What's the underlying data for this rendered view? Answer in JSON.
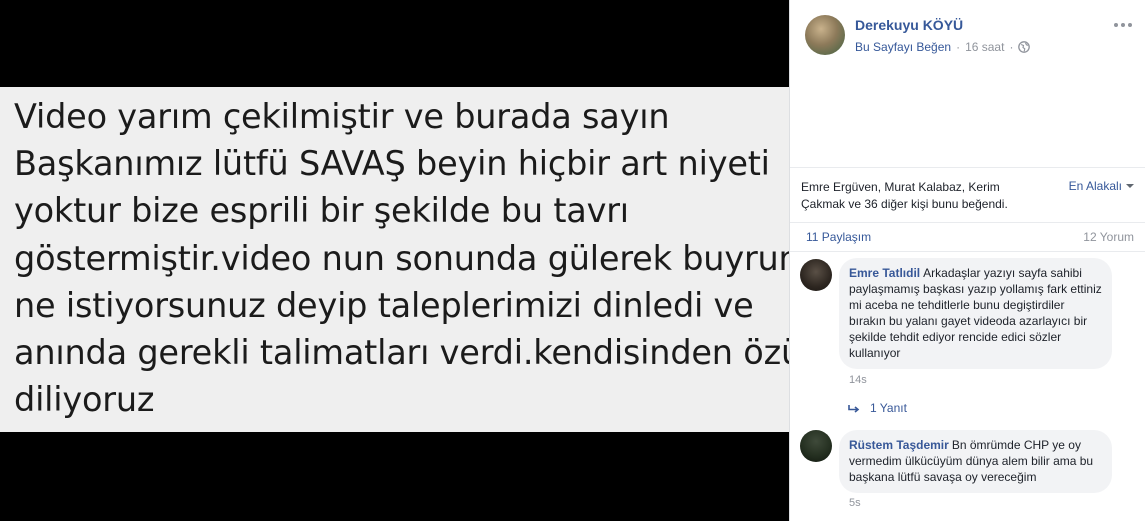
{
  "media": {
    "text": "Video yarım çekilmiştir ve burada sayın\nBaşkanımız lütfü SAVAŞ beyin hiçbir art niyeti\nyoktur bize esprili bir şekilde bu tavrı\ngöstermiştir.video nun sonunda gülerek buyrun\nne istiyorsunuz deyip taleplerimizi dinledi ve\nanında gerekli talimatları verdi.kendisinden özür\ndiliyoruz"
  },
  "post": {
    "page_name": "Derekuyu KÖYÜ",
    "like_page": "Bu Sayfayı Beğen",
    "separator": "·",
    "time": "16 saat",
    "privacy_icon": "globe-icon",
    "more_icon": "more-options-icon"
  },
  "reactions": {
    "text": "Emre Ergüven, Murat Kalabaz, Kerim Çakmak ve 36 diğer kişi bunu beğendi.",
    "sort_label": "En Alakalı"
  },
  "counts": {
    "shares": "11 Paylaşım",
    "comments": "12 Yorum"
  },
  "comments": [
    {
      "author": "Emre Tatlıdil",
      "text": "Arkadaşlar yazıyı sayfa sahibi paylaşmamış başkası yazıp yollamış fark ettiniz mi aceba ne tehditlerle bunu degiştirdiler bırakın bu yalanı gayet videoda azarlayıcı bir şekilde tehdit ediyor rencide edici sözler kullanıyor",
      "time": "14s",
      "reply_label": "1 Yanıt"
    },
    {
      "author": "Rüstem Taşdemir",
      "text": "Bn ömrümde CHP ye oy vermedim ülkücüyüm dünya alem bilir ama bu başkana lütfü savaşa oy vereceğim",
      "time": "5s"
    }
  ],
  "colors": {
    "link": "#365899",
    "meta": "#90949c",
    "bubble": "#f2f3f5",
    "media_bg": "#000000",
    "text_box": "#efefef"
  }
}
